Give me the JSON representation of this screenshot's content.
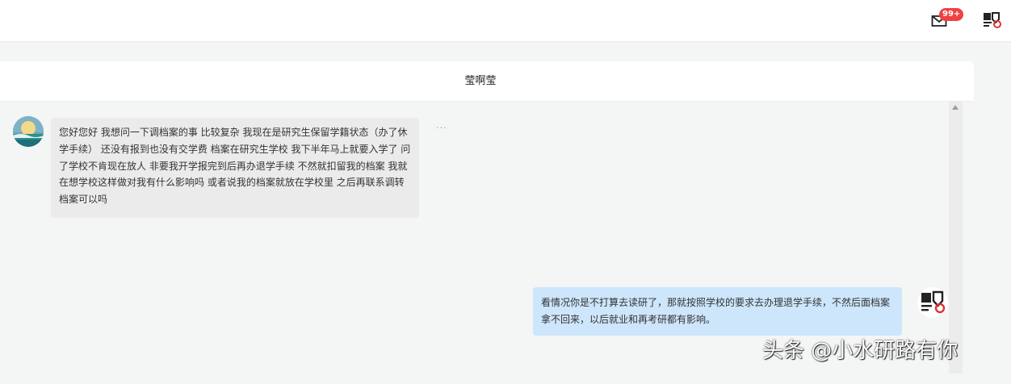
{
  "header": {
    "mail_icon": "mail-icon",
    "unread_badge": "99+",
    "avatar_icon": "user-avatar-seal"
  },
  "chat": {
    "title": "莹啊莹",
    "more_label": "···",
    "messages": [
      {
        "side": "left",
        "avatar_icon": "moon-landscape-avatar",
        "text": "您好您好 我想问一下调档案的事 比较复杂 我现在是研究生保留学籍状态（办了休学手续） 还没有报到也没有交学费 档案在研究生学校 我下半年马上就要入学了 问了学校不肯现在放人 非要我开学报完到后再办退学手续 不然就扣留我的档案 我就在想学校这样做对我有什么影响吗 或者说我的档案就放在学校里 之后再联系调转档案可以吗"
      },
      {
        "side": "right",
        "avatar_icon": "user-avatar-seal",
        "text": "看情况你是不打算去读研了，那就按照学校的要求去办理退学手续，不然后面档案拿不回来，以后就业和再考研都有影响。"
      }
    ]
  },
  "watermark": "头条 @小水研路有你",
  "colors": {
    "badge": "#f04142",
    "incoming_bubble": "#ebebeb",
    "outgoing_bubble": "#cde6fc",
    "background": "#f4f5f5"
  }
}
